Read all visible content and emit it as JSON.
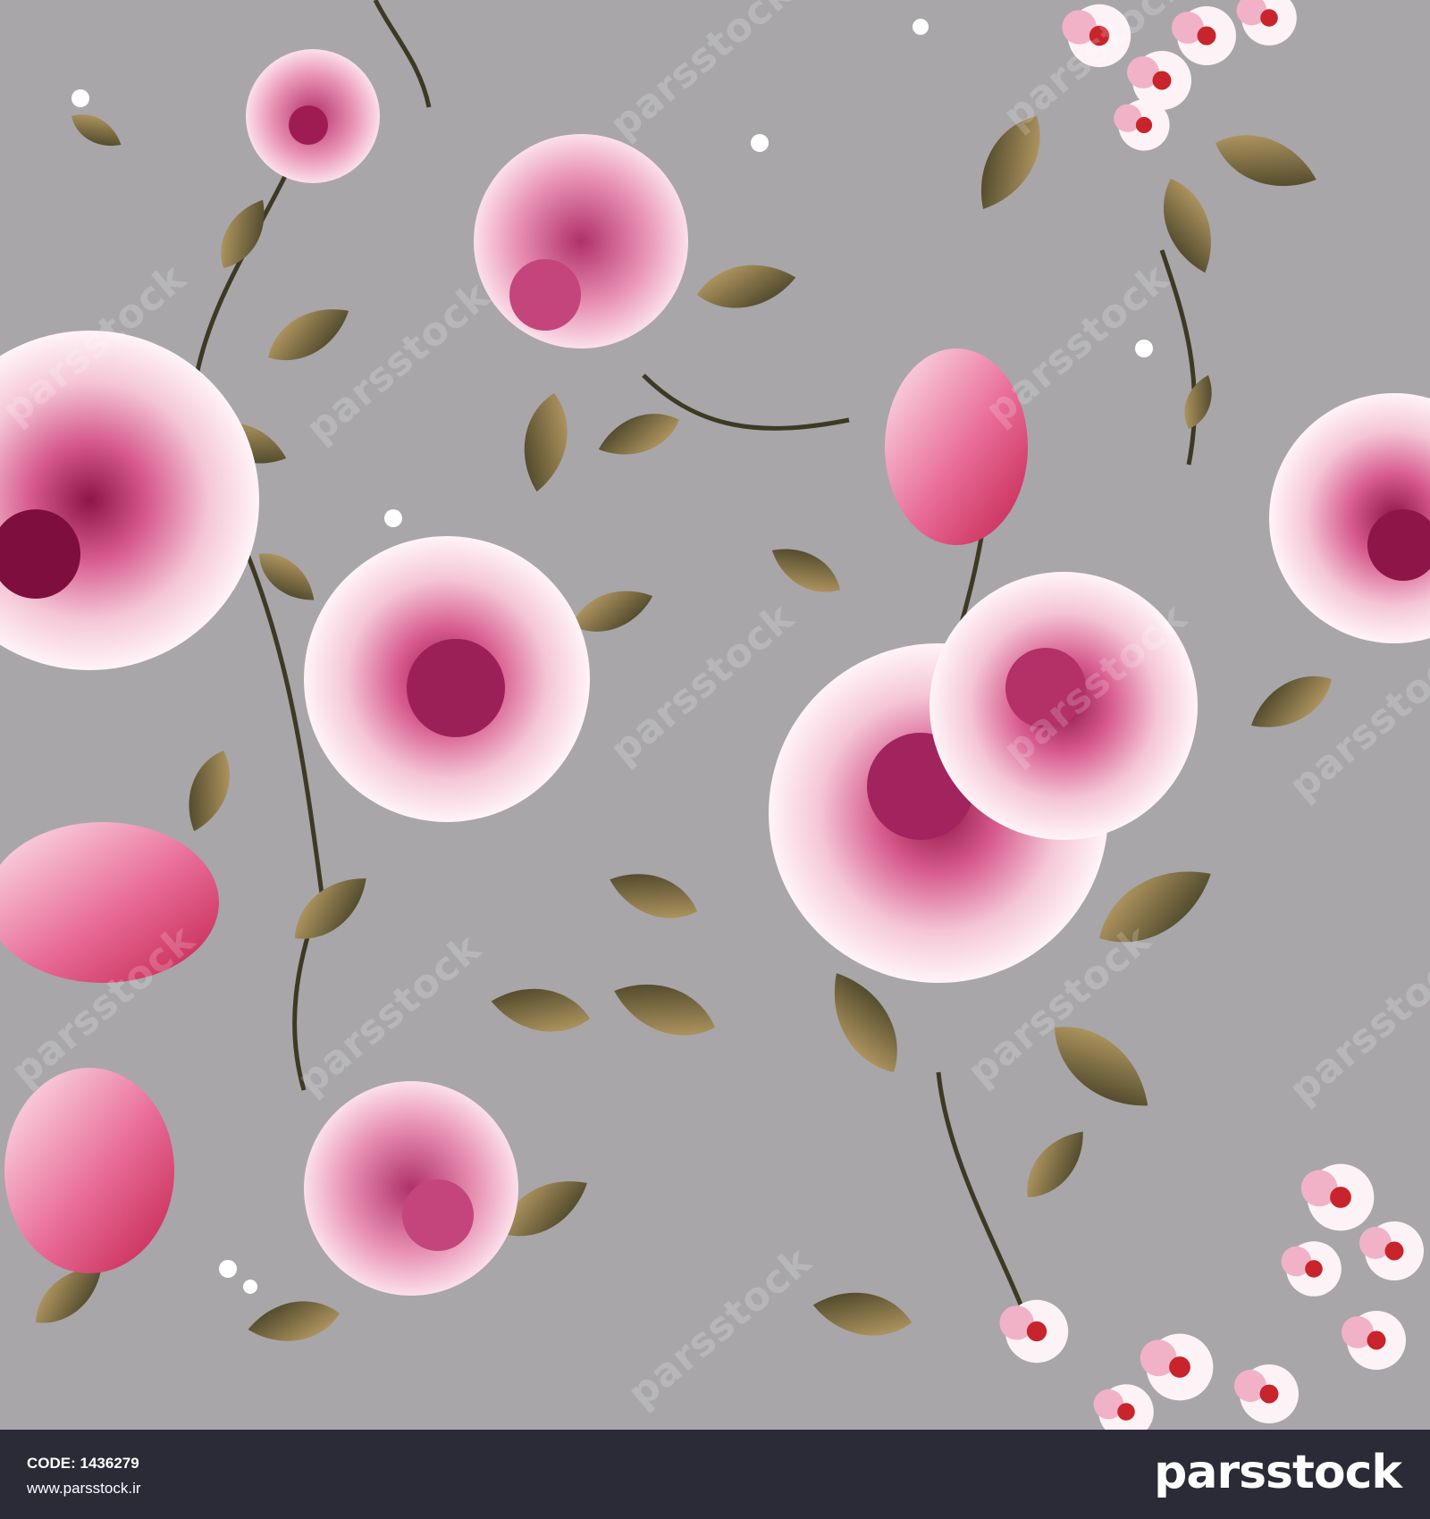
{
  "footer": {
    "code": "CODE: 1436279",
    "url": "www.parsstock.ir",
    "logo": "parsstock"
  },
  "watermark": {
    "text": "parsstock"
  },
  "colors": {
    "background": "#a8a6a9",
    "footer": "#2a2b36",
    "petal_light": "#f6d4df",
    "petal_mid": "#e07aa3",
    "petal_dark": "#a01a55",
    "leaf_dark": "#3f3d26",
    "leaf_light": "#a08a55",
    "blossom_red": "#c8242b"
  }
}
